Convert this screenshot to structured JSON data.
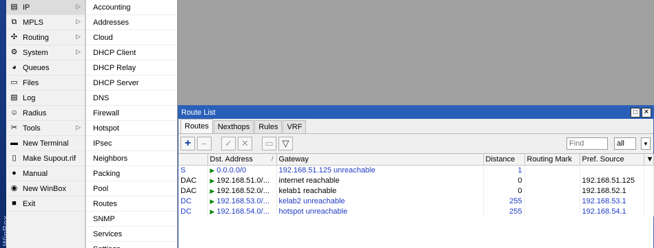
{
  "brand": "WinBox",
  "main_menu": [
    {
      "label": "IP",
      "icon": "ip-icon",
      "submenu": true
    },
    {
      "label": "MPLS",
      "icon": "mpls-icon",
      "submenu": true
    },
    {
      "label": "Routing",
      "icon": "routing-icon",
      "submenu": true
    },
    {
      "label": "System",
      "icon": "gear-icon",
      "submenu": true
    },
    {
      "label": "Queues",
      "icon": "queues-icon",
      "submenu": false
    },
    {
      "label": "Files",
      "icon": "folder-icon",
      "submenu": false
    },
    {
      "label": "Log",
      "icon": "log-icon",
      "submenu": false
    },
    {
      "label": "Radius",
      "icon": "users-icon",
      "submenu": false
    },
    {
      "label": "Tools",
      "icon": "tools-icon",
      "submenu": true
    },
    {
      "label": "New Terminal",
      "icon": "terminal-icon",
      "submenu": false
    },
    {
      "label": "Make Supout.rif",
      "icon": "document-icon",
      "submenu": false
    },
    {
      "label": "Manual",
      "icon": "help-icon",
      "submenu": false
    },
    {
      "label": "New WinBox",
      "icon": "winbox-icon",
      "submenu": false
    },
    {
      "label": "Exit",
      "icon": "exit-icon",
      "submenu": false
    }
  ],
  "sub_menu": [
    "Accounting",
    "Addresses",
    "Cloud",
    "DHCP Client",
    "DHCP Relay",
    "DHCP Server",
    "DNS",
    "Firewall",
    "Hotspot",
    "IPsec",
    "Neighbors",
    "Packing",
    "Pool",
    "Routes",
    "SNMP",
    "Services",
    "Settings"
  ],
  "window": {
    "title": "Route List",
    "tabs": [
      "Routes",
      "Nexthops",
      "Rules",
      "VRF"
    ],
    "find_placeholder": "Find",
    "find_scope": "all"
  },
  "table": {
    "columns": [
      "",
      "Dst. Address",
      "Gateway",
      "Distance",
      "Routing Mark",
      "Pref. Source"
    ],
    "rows": [
      {
        "flags": "S",
        "dst": "0.0.0.0/0",
        "gateway": "192.168.51.125 unreachable",
        "distance": "1",
        "mark": "",
        "pref": "",
        "dynamic": true
      },
      {
        "flags": "DAC",
        "dst": "192.168.51.0/...",
        "gateway": "internet reachable",
        "distance": "0",
        "mark": "",
        "pref": "192.168.51.125",
        "dynamic": false
      },
      {
        "flags": "DAC",
        "dst": "192.168.52.0/...",
        "gateway": "kelab1 reachable",
        "distance": "0",
        "mark": "",
        "pref": "192.168.52.1",
        "dynamic": false
      },
      {
        "flags": "DC",
        "dst": "192.168.53.0/...",
        "gateway": "kelab2 unreachable",
        "distance": "255",
        "mark": "",
        "pref": "192.168.53.1",
        "dynamic": true
      },
      {
        "flags": "DC",
        "dst": "192.168.54.0/...",
        "gateway": "hotspot unreachable",
        "distance": "255",
        "mark": "",
        "pref": "192.168.54.1",
        "dynamic": true
      }
    ]
  },
  "colors": {
    "titlebar": "#2a5fb8",
    "unreachable_text": "#1e3bc5",
    "flag_green": "#0d8a0d"
  }
}
